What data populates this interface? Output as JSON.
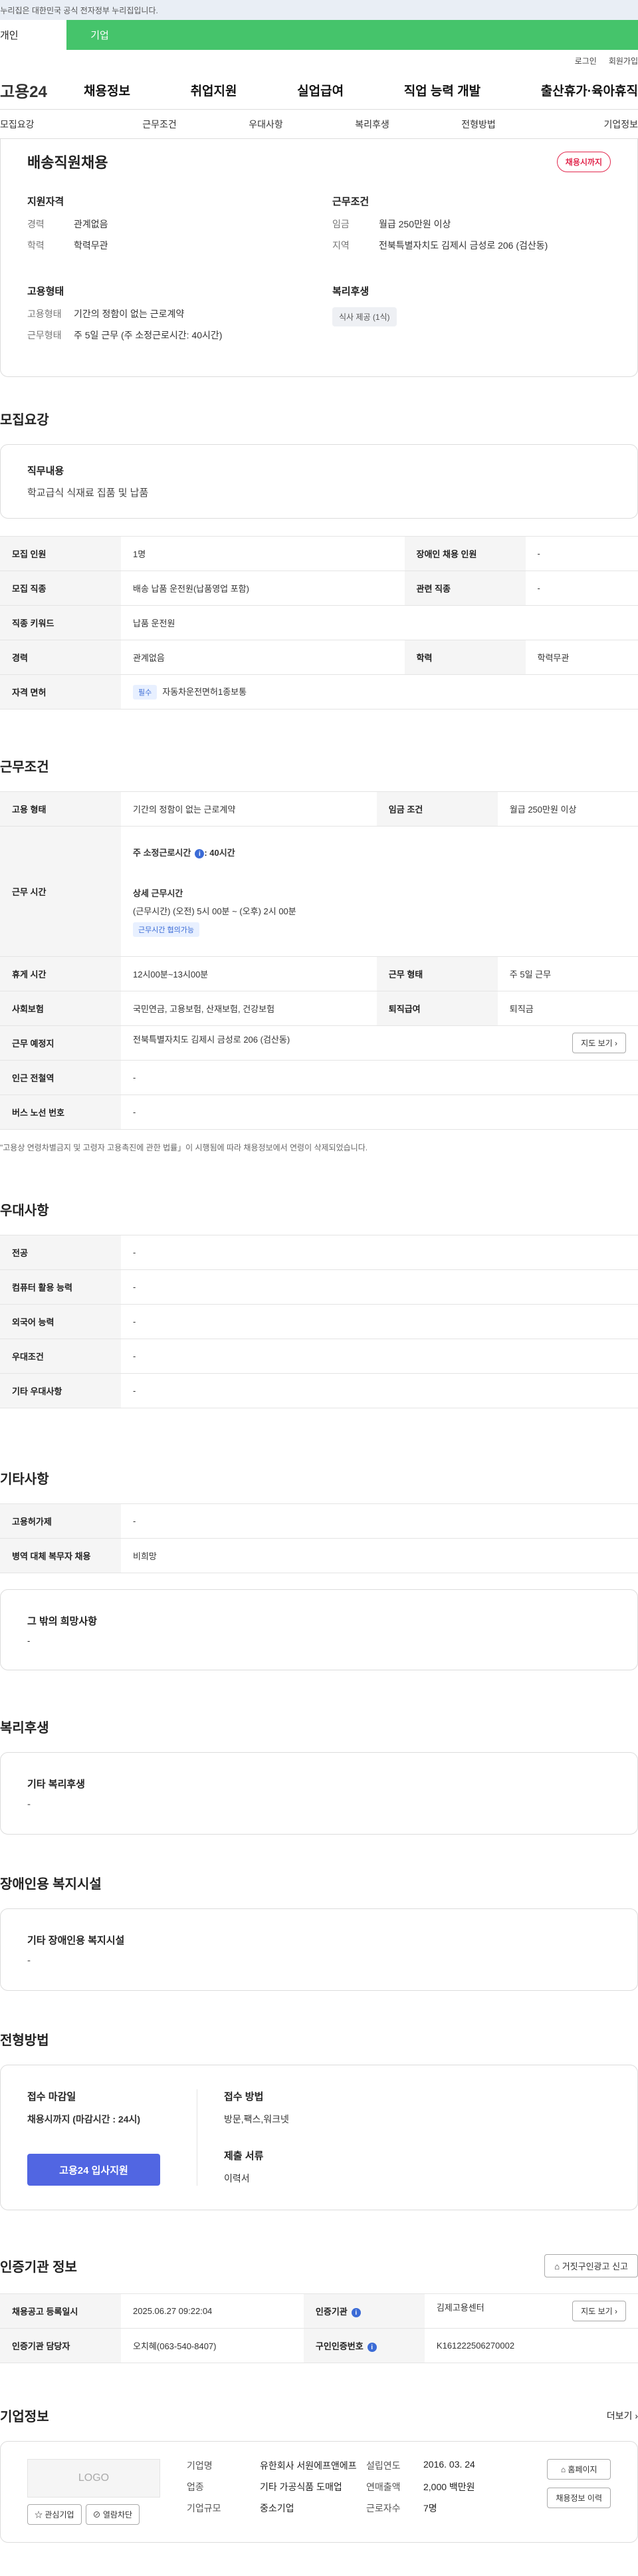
{
  "gov_banner": "이 누리집은 대한민국 공식 전자정부 누리집입니다.",
  "tabs": [
    "개인",
    "기업"
  ],
  "util": {
    "login": "로그인",
    "join": "회원가입"
  },
  "gnb": {
    "logo": "고용24",
    "menu": [
      "채용정보",
      "취업지원",
      "실업급여",
      "직업 능력 개발",
      "출산휴가·육아휴직"
    ]
  },
  "anchors": [
    "모집요강",
    "근무조건",
    "우대사항",
    "복리후생",
    "전형방법",
    "기업정보"
  ],
  "summary": {
    "title": "배송직원채용",
    "status": "채용시까지",
    "qual": {
      "title": "지원자격",
      "rows": [
        [
          "경력",
          "관계없음"
        ],
        [
          "학력",
          "학력무관"
        ]
      ]
    },
    "cond": {
      "title": "근무조건",
      "rows": [
        [
          "임금",
          "월급 250만원 이상"
        ],
        [
          "지역",
          "전북특별자치도 김제시 금성로 206 (검산동)"
        ]
      ]
    },
    "form": {
      "title": "고용형태",
      "rows": [
        [
          "고용형태",
          "기간의 정함이 없는 근로계약"
        ],
        [
          "근무형태",
          "주 5일 근무 (주 소정근로시간: 40시간)"
        ]
      ]
    },
    "welfare": {
      "title": "복리후생",
      "chip": "식사 제공 (1식)"
    }
  },
  "recruit": {
    "title": "모집요강",
    "duty_label": "직무내용",
    "duty": "학교급식 식재료 집품 및 납품",
    "rows": [
      [
        "모집 인원",
        "1명",
        "장애인 채용 인원",
        "-"
      ],
      [
        "모집 직종",
        "배송 납품 운전원(납품영업 포함)",
        "관련 직종",
        "-"
      ],
      [
        "직종 키워드",
        "납품 운전원"
      ],
      [
        "경력",
        "관계없음",
        "학력",
        "학력무관"
      ]
    ],
    "cert_label": "자격 면허",
    "cert_tag": "필수",
    "cert": "자동차운전면허1종보통"
  },
  "work": {
    "title": "근무조건",
    "type_l": "고용 형태",
    "type": "기간의 정함이 없는 근로계약",
    "wage_l": "임금 조건",
    "wage": "월급 250만원 이상",
    "hours_l": "근무 시간",
    "hours_main": "주 소정근로시간",
    "hours_val": ": 40시간",
    "detail_l": "상세 근무시간",
    "detail": "(근무시간) (오전) 5시 00분 ~ (오후) 2시 00분",
    "negotiable": "근무시간 협의가능",
    "break_l": "휴게 시간",
    "break": "12시00분~13시00분",
    "form_l": "근무 형태",
    "form": "주 5일 근무",
    "ins_l": "사회보험",
    "ins": "국민연금, 고용보험, 산재보험, 건강보험",
    "sev_l": "퇴직급여",
    "sev": "퇴직금",
    "place_l": "근무 예정지",
    "place": "전북특별자치도 김제시 금성로 206 (검산동)",
    "map": "지도 보기",
    "subway_l": "인근 전철역",
    "subway": "-",
    "bus_l": "버스 노선 번호",
    "bus": "-",
    "note": "\"고용상 연령차별금지 및 고령자 고용촉진에 관한 법률」이 시행됨에 따라 채용정보에서 연령이 삭제되었습니다."
  },
  "pref": {
    "title": "우대사항",
    "rows": [
      [
        "전공",
        "-"
      ],
      [
        "컴퓨터 활용 능력",
        "-"
      ],
      [
        "외국어 능력",
        "-"
      ],
      [
        "우대조건",
        "-"
      ],
      [
        "기타 우대사항",
        "-"
      ]
    ]
  },
  "etc": {
    "title": "기타사항",
    "rows": [
      [
        "고용허가제",
        "-"
      ],
      [
        "병역 대체 복무자 채용",
        "비희망"
      ]
    ],
    "other_label": "그 밖의 희망사항",
    "other": "-"
  },
  "benefit": {
    "title": "복리후생",
    "label": "기타 복리후생",
    "value": "-"
  },
  "disab": {
    "title": "장애인용 복지시설",
    "label": "기타 장애인용 복지시설",
    "value": "-"
  },
  "select": {
    "title": "전형방법",
    "deadline_l": "접수 마감일",
    "deadline": "채용시까지 (마감시간 : 24시)",
    "apply": "고용24 입사지원",
    "method_l": "접수 방법",
    "method": "방문,팩스,워크넷",
    "docs_l": "제출 서류",
    "docs": "이력서"
  },
  "agency": {
    "title": "인증기관 정보",
    "report": "거짓구인광고 신고",
    "rows": [
      [
        "채용공고 등록일시",
        "2025.06.27 09:22:04",
        "인증기관",
        "김제고용센터"
      ],
      [
        "인증기관 담당자",
        "오치혜(063-540-8407)",
        "구인인증번호",
        "K161222506270002"
      ]
    ],
    "map": "지도 보기"
  },
  "company": {
    "title": "기업정보",
    "more": "더보기",
    "logo": "LOGO",
    "fav": "관심기업",
    "block": "열람차단",
    "rows": [
      [
        "기업명",
        "유한회사 서원에프앤에프",
        "설립연도",
        "2016. 03. 24"
      ],
      [
        "업종",
        "기타 가공식품 도매업",
        "연매출액",
        "2,000 백만원"
      ],
      [
        "기업규모",
        "중소기업",
        "근로자수",
        "7명"
      ]
    ],
    "home": "홈페이지",
    "history": "채용정보 이력"
  }
}
